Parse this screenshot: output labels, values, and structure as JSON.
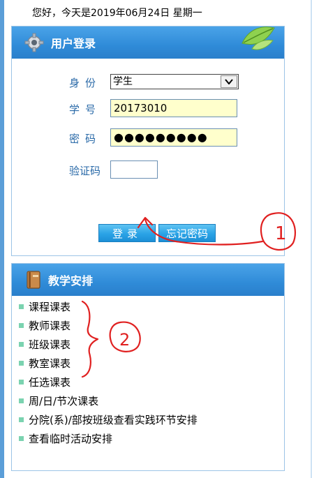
{
  "header": {
    "greeting": "您好，今天是2019年06月24日  星期一"
  },
  "login": {
    "title": "用户登录",
    "role_label": "身份",
    "role_value": "学生",
    "id_label": "学号",
    "id_value": "20173010",
    "password_label": "密码",
    "password_value": "●●●●●●●●●",
    "captcha_label": "验证码",
    "captcha_value": "",
    "login_button": "登录",
    "forgot_button": "忘记密码"
  },
  "schedule": {
    "title": "教学安排",
    "items": [
      "课程课表",
      "教师课表",
      "班级课表",
      "教室课表",
      "任选课表",
      "周/日/节次课表",
      "分院(系)/部按班级查看实践环节安排",
      "查看临时活动安排"
    ]
  },
  "annotations": {
    "mark_1": "1",
    "mark_2": "2",
    "color": "#e02020"
  },
  "colors": {
    "header_blue": "#2f8bd8",
    "label_blue": "#2a6aa8",
    "input_yellow": "#ffffcc"
  }
}
